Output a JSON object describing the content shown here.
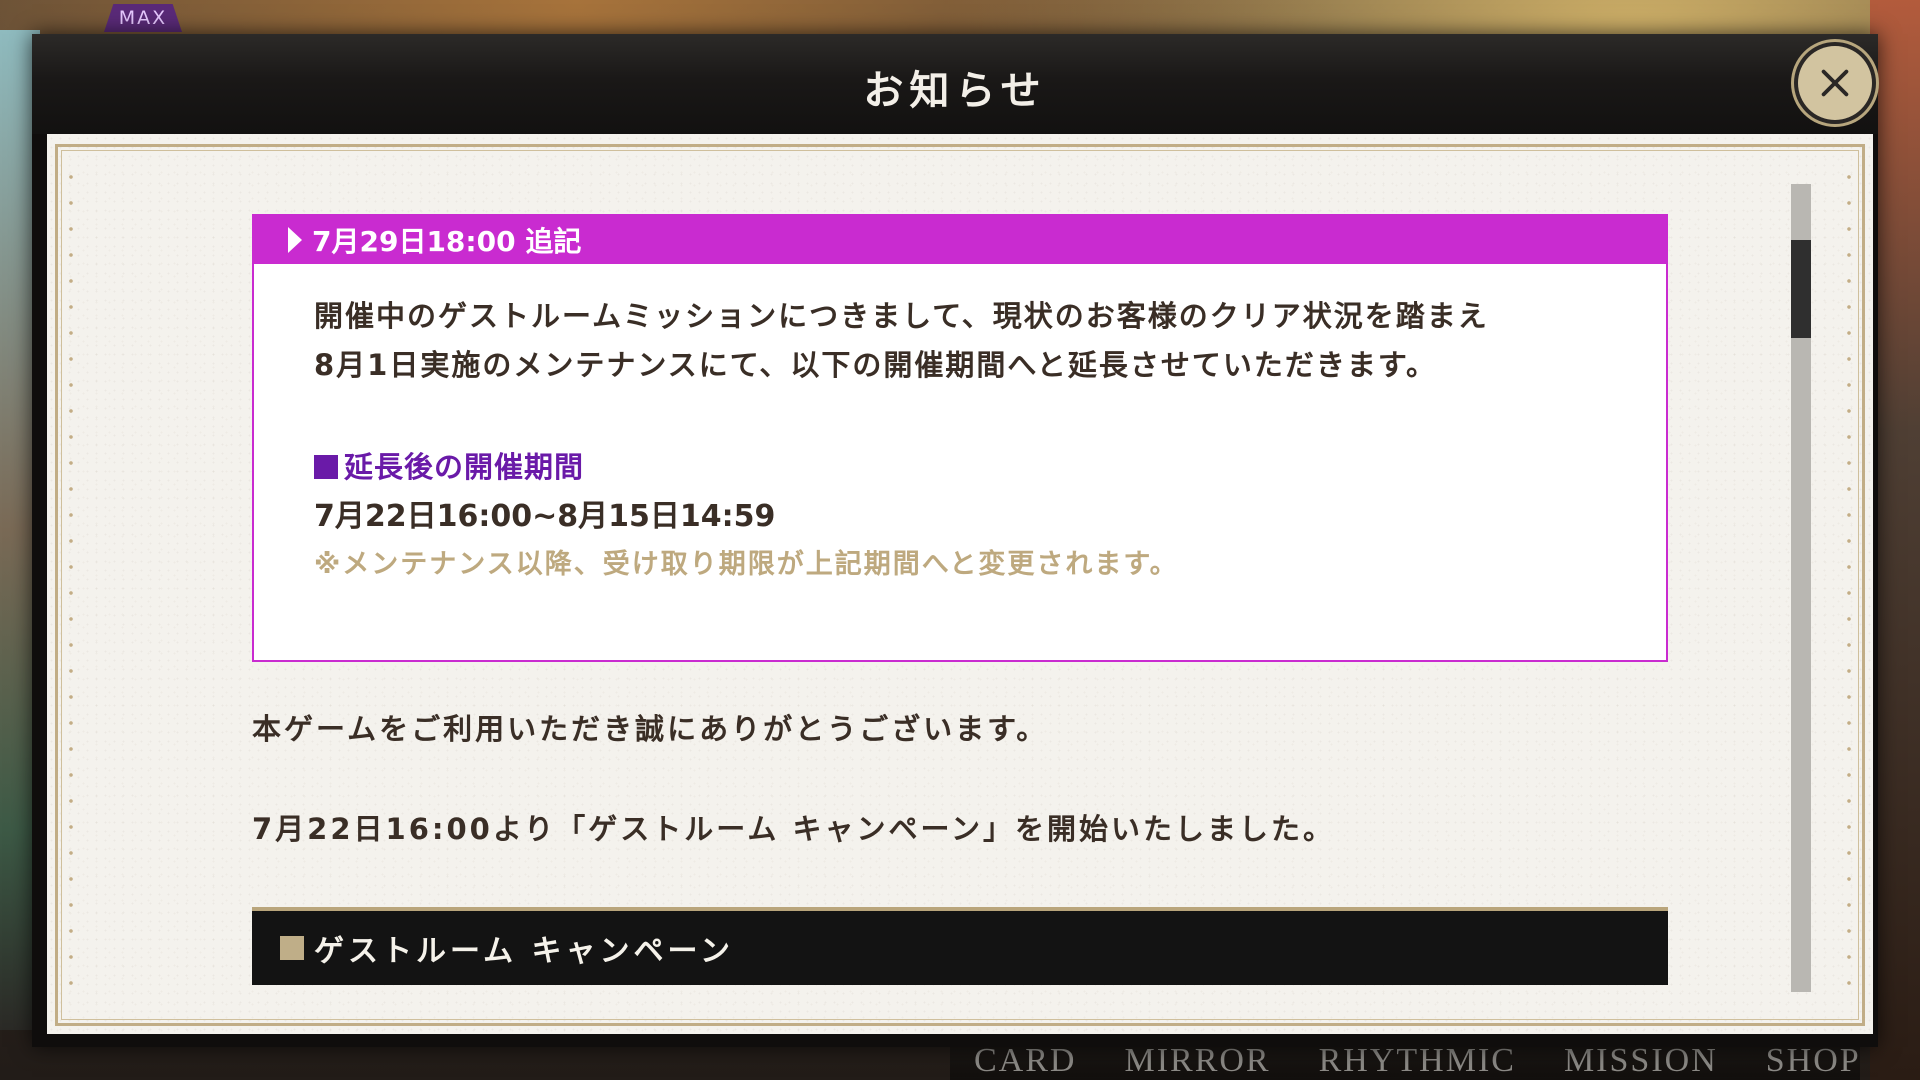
{
  "hud": {
    "max_badge": "MAX",
    "nav": [
      "CARD",
      "MIRROR",
      "RHYTHMIC",
      "MISSION",
      "SHOP"
    ]
  },
  "dialog": {
    "title": "お知らせ",
    "close_icon": "close-icon"
  },
  "addendum": {
    "header": "7月29日18:00 追記",
    "body_lines": [
      "開催中のゲストルームミッションにつきまして、現状のお客様のクリア状況を踏まえ",
      "8月1日実施のメンテナンスにて、以下の開催期間へと延長させていただきます。"
    ],
    "period_title": "延長後の開催期間",
    "period_date": "7月22日16:00~8月15日14:59",
    "period_note": "※メンテナンス以降、受け取り期限が上記期間へと変更されます。"
  },
  "main": {
    "lines": [
      "本ゲームをご利用いただき誠にありがとうございます。",
      "7月22日16:00より「ゲストルーム キャンペーン」を開始いたしました。"
    ],
    "section_title": "ゲストルーム キャンペーン"
  },
  "colors": {
    "accent_magenta": "#c92bd0",
    "period_purple": "#6a1aa8",
    "note_gold": "#bea97f",
    "frame_gold": "#c1ad86"
  }
}
